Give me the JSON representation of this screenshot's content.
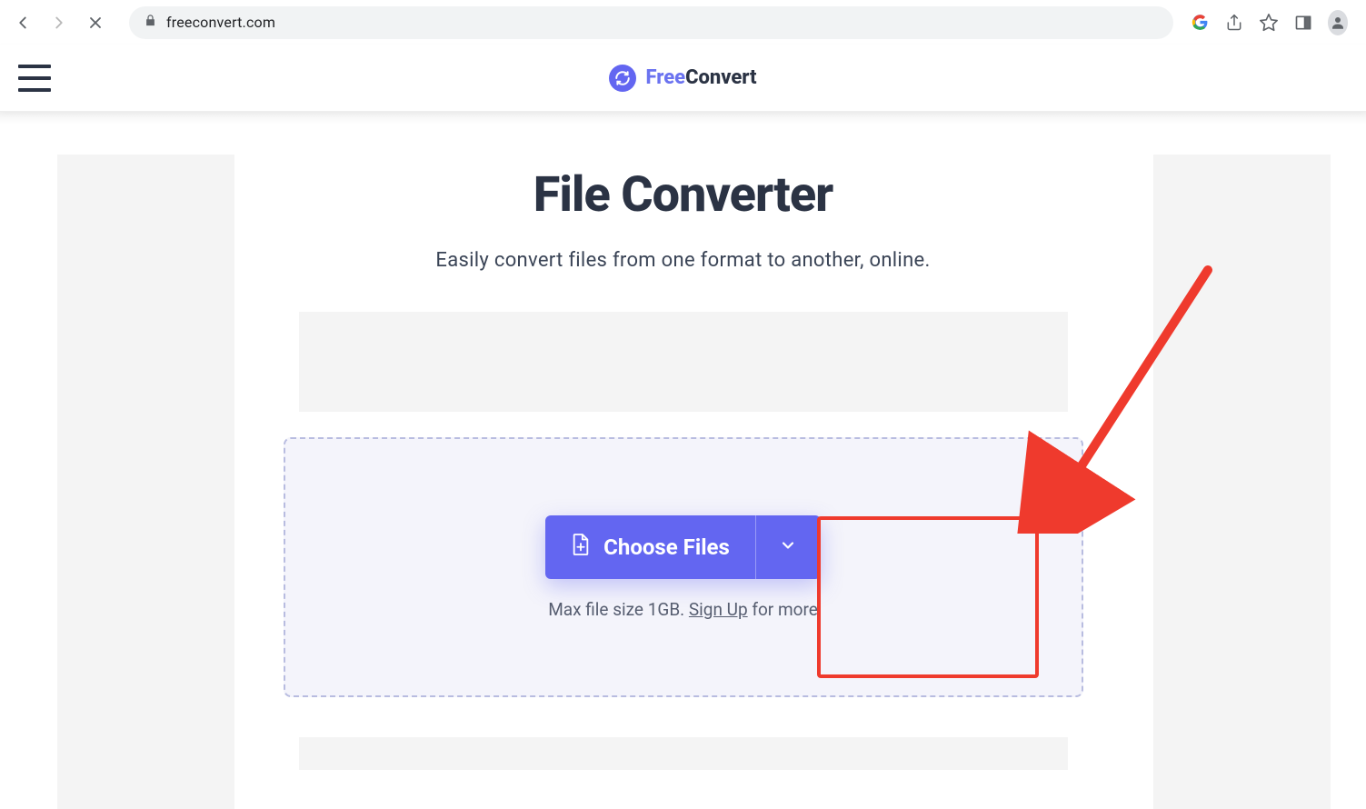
{
  "browser": {
    "url": "freeconvert.com"
  },
  "header": {
    "brand_free": "Free",
    "brand_convert": "Convert"
  },
  "main": {
    "title": "File Converter",
    "subtitle": "Easily convert files from one format to another, online.",
    "choose_files": "Choose Files",
    "hint_prefix": "Max file size 1GB. ",
    "hint_link": "Sign Up",
    "hint_suffix": " for more"
  }
}
